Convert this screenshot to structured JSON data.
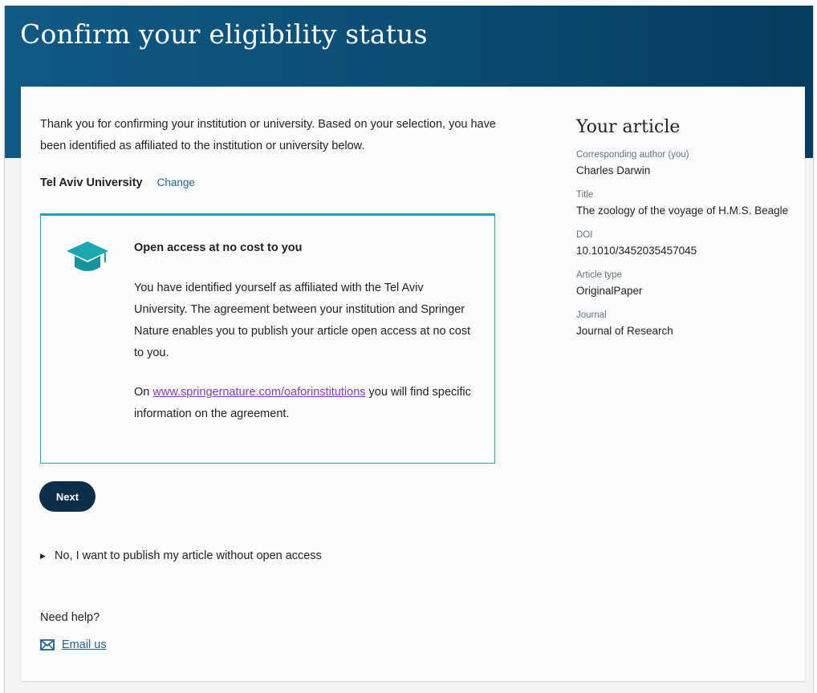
{
  "page": {
    "title": "Confirm your eligibility status"
  },
  "intro": {
    "text": "Thank you for confirming your institution or university. Based on your selection, you have been identified as affiliated to the institution or university below.",
    "institution": "Tel Aviv University",
    "change_label": "Change"
  },
  "oa_box": {
    "icon": "graduation-cap-icon",
    "heading": "Open access at no cost to you",
    "body": "You have identified yourself as affiliated with the Tel Aviv University. The agreement between your institution and Springer Nature enables you to publish your article open access at no cost to you.",
    "link_prefix": "On ",
    "link_text": "www.springernature.com/oaforinstitutions",
    "link_suffix": " you will find specific information on the agreement.",
    "accent_color": "#1ba6b0"
  },
  "actions": {
    "next_label": "Next",
    "decline_label": "No, I want to publish my article without open access"
  },
  "help": {
    "heading": "Need help?",
    "email_label": "Email us",
    "icon": "envelope-icon"
  },
  "sidebar": {
    "title": "Your article",
    "fields": [
      {
        "label": "Corresponding author (you)",
        "value": "Charles Darwin"
      },
      {
        "label": "Title",
        "value": "The zoology of the voyage of H.M.S. Beagle"
      },
      {
        "label": "DOI",
        "value": "10.1010/3452035457045"
      },
      {
        "label": "Article type",
        "value": "OriginalPaper"
      },
      {
        "label": "Journal",
        "value": "Journal of Research"
      }
    ]
  },
  "colors": {
    "banner": "#0b4c72",
    "button": "#0b2e49",
    "link": "#1f6390",
    "visited_link": "#8b3bbd"
  }
}
